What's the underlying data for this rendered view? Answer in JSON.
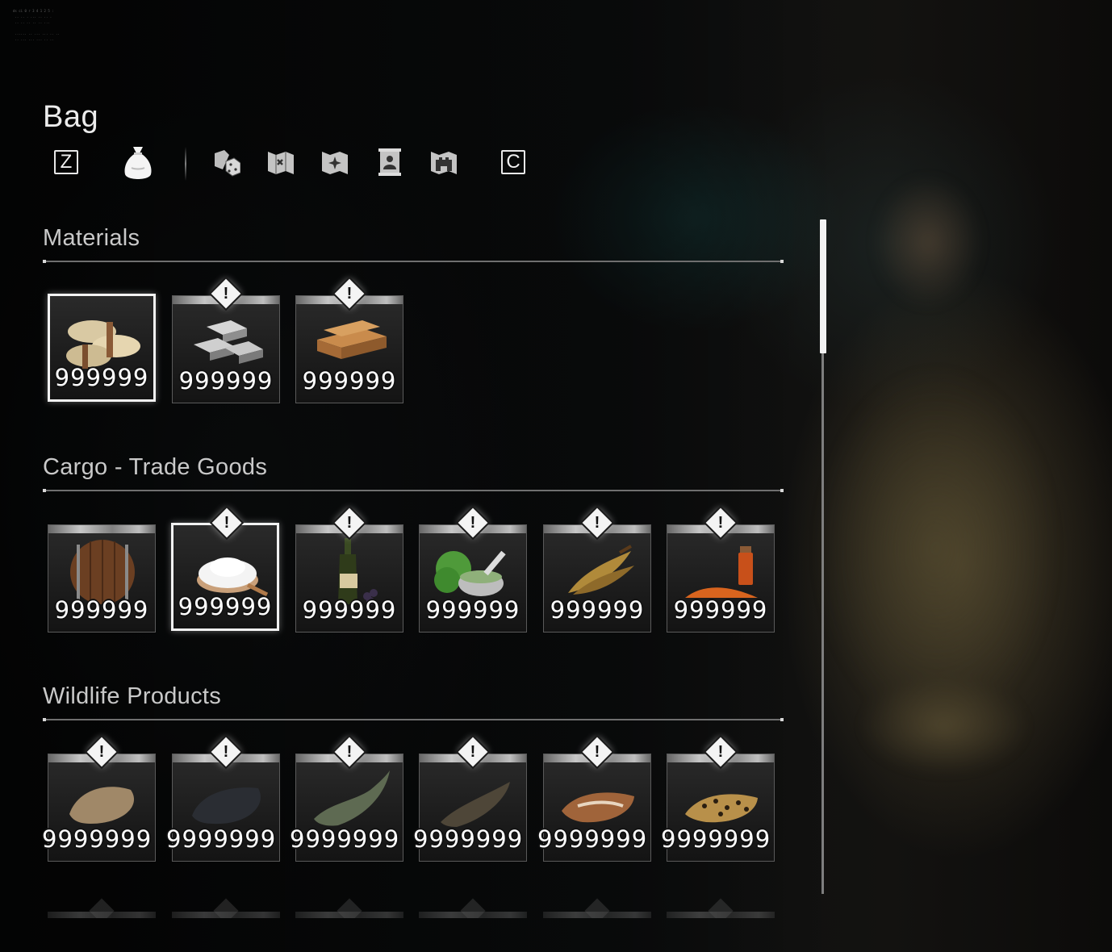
{
  "debug_overlay": "ds ci 0 r 3 4 1 2 5 :\n .. .. . ... .. .. .\n .. .. .. .. .. ...\n\n ...... .. ... ... .. ..\n .. ... ... ... .. ..",
  "header": {
    "title": "Bag"
  },
  "toolbar": {
    "prev_key": "Z",
    "next_key": "C",
    "tabs": [
      {
        "icon": "money-bag-icon",
        "active": true
      },
      {
        "icon": "map-dice-icon",
        "active": false
      },
      {
        "icon": "treasure-map-icon",
        "active": false
      },
      {
        "icon": "compass-map-icon",
        "active": false
      },
      {
        "icon": "portrait-scroll-icon",
        "active": false
      },
      {
        "icon": "fortress-map-icon",
        "active": false
      }
    ]
  },
  "sections": [
    {
      "title": "Materials",
      "items": [
        {
          "icon": "cloth-rolls-icon",
          "count": "999999",
          "new": false,
          "selected": true
        },
        {
          "icon": "iron-ingots-icon",
          "count": "999999",
          "new": true,
          "selected": false
        },
        {
          "icon": "wood-planks-icon",
          "count": "999999",
          "new": true,
          "selected": false
        }
      ]
    },
    {
      "title": "Cargo - Trade Goods",
      "items": [
        {
          "icon": "barrel-icon",
          "count": "999999",
          "new": false,
          "selected": false
        },
        {
          "icon": "salt-bowl-icon",
          "count": "999999",
          "new": true,
          "selected": true
        },
        {
          "icon": "wine-bottle-icon",
          "count": "999999",
          "new": true,
          "selected": false
        },
        {
          "icon": "herbs-mortar-icon",
          "count": "999999",
          "new": true,
          "selected": false
        },
        {
          "icon": "tobacco-leaves-icon",
          "count": "999999",
          "new": true,
          "selected": false
        },
        {
          "icon": "spice-jar-icon",
          "count": "999999",
          "new": true,
          "selected": false
        }
      ]
    },
    {
      "title": "Wildlife Products",
      "items": [
        {
          "icon": "rabbit-pelt-icon",
          "count": "9999999",
          "new": true,
          "selected": false
        },
        {
          "icon": "dark-pelt-icon",
          "count": "9999999",
          "new": true,
          "selected": false
        },
        {
          "icon": "crocodile-hide-icon",
          "count": "9999999",
          "new": true,
          "selected": false
        },
        {
          "icon": "snake-skin-icon",
          "count": "9999999",
          "new": true,
          "selected": false
        },
        {
          "icon": "fox-pelt-icon",
          "count": "9999999",
          "new": true,
          "selected": false
        },
        {
          "icon": "leopard-pelt-icon",
          "count": "9999999",
          "new": true,
          "selected": false
        }
      ]
    }
  ],
  "badge_symbol": "!",
  "scrollbar": {
    "position": 0.0,
    "visible_fraction": 0.2
  },
  "colors": {
    "text": "#e6e6e6",
    "section": "#c9c9c9",
    "accent": "#f2f2f2",
    "background": "#0b0c0d"
  }
}
